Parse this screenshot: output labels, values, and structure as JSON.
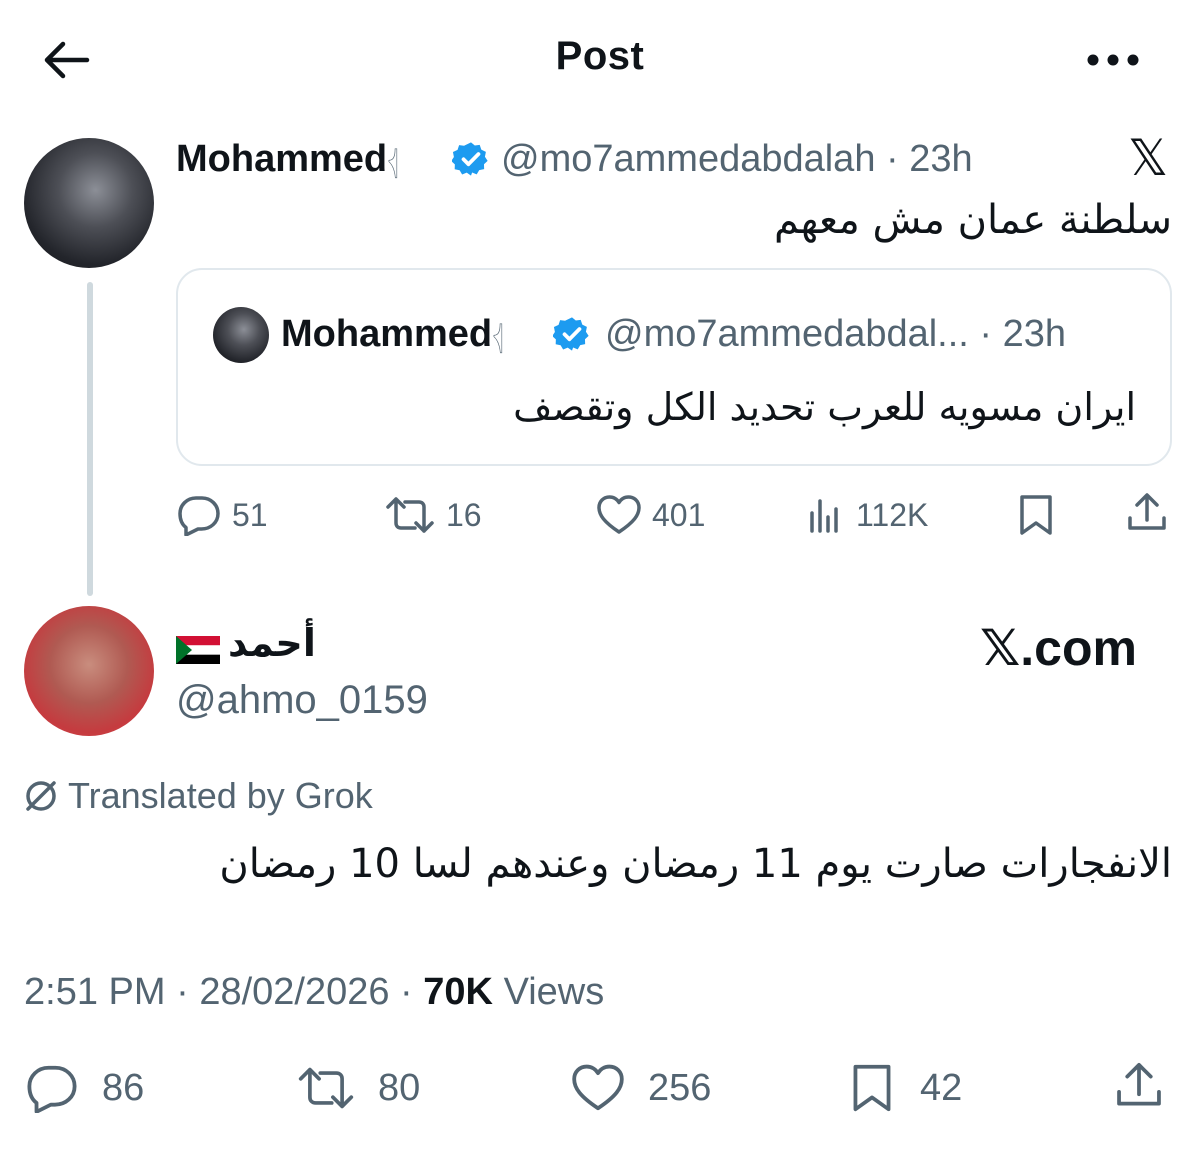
{
  "header": {
    "title": "Post"
  },
  "main_post": {
    "name": "Mohammed",
    "name_suffix": "𓂆",
    "handle": "@mo7ammedabdalah",
    "time": "· 23h",
    "text": "سلطنة عمان مش معهم",
    "quote": {
      "name": "Mohammed",
      "name_suffix": "𓂆",
      "handle": "@mo7ammedabdal...",
      "time": "· 23h",
      "text": "ايران مسويه للعرب تحديد الكل وتقصف"
    },
    "actions": {
      "replies": "51",
      "reposts": "16",
      "likes": "401",
      "views": "112K"
    }
  },
  "reply_post": {
    "name": "أحمد",
    "handle": "@ahmo_0159",
    "watermark": "𝕏.com",
    "translated_label": "Translated by Grok",
    "text": "الانفجارات صارت يوم 11 رمضان وعندهم لسا 10 رمضان",
    "time": "2:51 PM",
    "date": "28/02/2026",
    "views_count": "70K",
    "views_label": "Views",
    "actions": {
      "replies": "86",
      "reposts": "80",
      "likes": "256",
      "bookmarks": "42"
    }
  },
  "colors": {
    "text": "#0f1419",
    "secondary": "#536471",
    "verified": "#1d9bf0",
    "border": "#e1e8ed"
  }
}
